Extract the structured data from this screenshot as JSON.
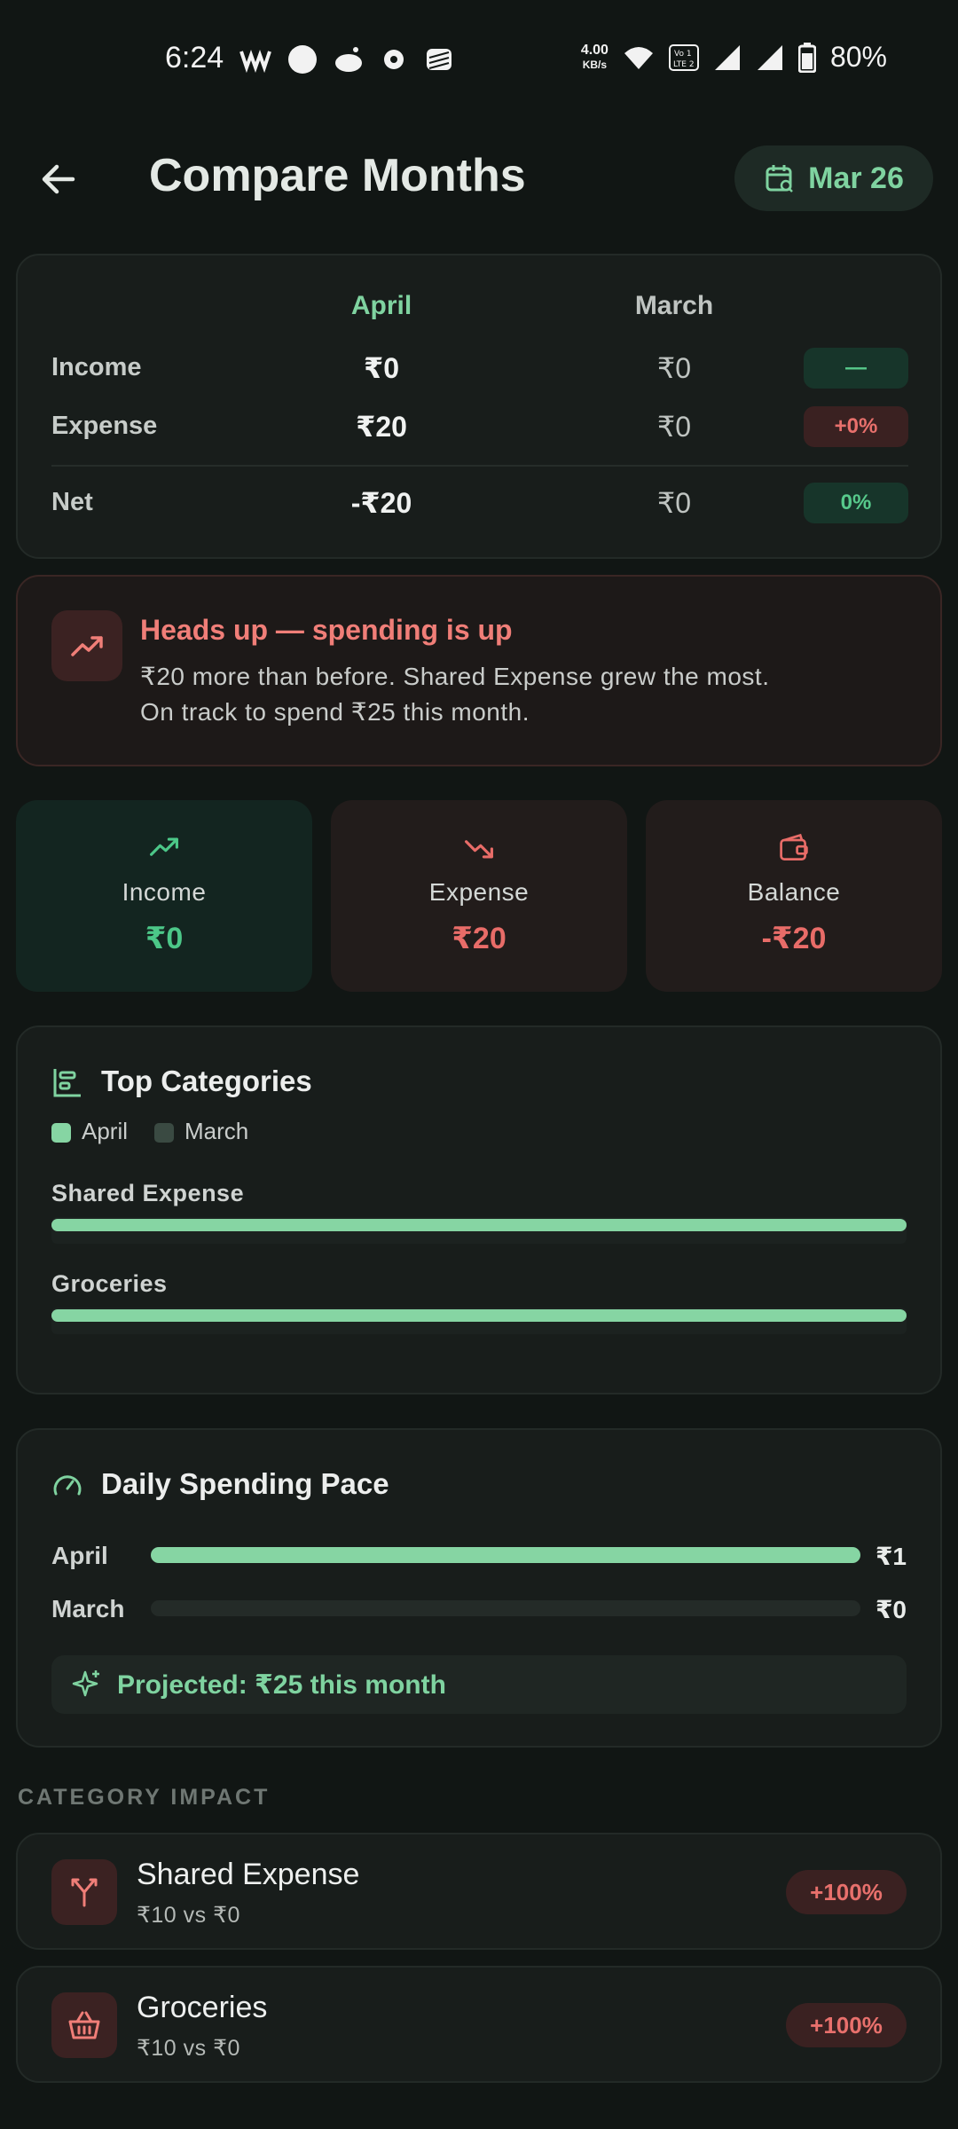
{
  "status_bar": {
    "time": "6:24",
    "net_speed": "4.00",
    "net_unit": "KB/s",
    "volte": "Vo LTE 2",
    "battery": "80%",
    "icons": [
      "webtoon-icon",
      "circle-icon",
      "reddit-icon",
      "settings-gear-icon",
      "stack-icon",
      "wifi-icon",
      "signal-icon",
      "signal-icon",
      "battery-icon"
    ]
  },
  "header": {
    "title": "Compare Months",
    "date_chip": "Mar 26",
    "back_icon": "arrow-left-icon",
    "date_icon": "calendar-search-icon"
  },
  "compare": {
    "col_current": "April",
    "col_previous": "March",
    "rows": [
      {
        "label": "Income",
        "current": "₹0",
        "previous": "₹0",
        "change": "—"
      },
      {
        "label": "Expense",
        "current": "₹20",
        "previous": "₹0",
        "change": "+0%"
      },
      {
        "label": "Net",
        "current": "-₹20",
        "previous": "₹0",
        "change": "0%"
      }
    ]
  },
  "alert": {
    "icon": "trending-up-icon",
    "title": "Heads up — spending is up",
    "line1": "₹20 more than before. Shared Expense grew the most.",
    "line2": "On track to spend ₹25 this month."
  },
  "tiles": [
    {
      "label": "Income",
      "value": "₹0",
      "icon": "trending-up-icon",
      "color": "#4cc788"
    },
    {
      "label": "Expense",
      "value": "₹20",
      "icon": "trending-down-icon",
      "color": "#e86c68"
    },
    {
      "label": "Balance",
      "value": "-₹20",
      "icon": "wallet-icon",
      "color": "#e86c68"
    }
  ],
  "top_categories": {
    "title": "Top Categories",
    "icon": "bar-chart-icon",
    "legend": [
      "April",
      "March"
    ],
    "items": [
      {
        "label": "Shared Expense",
        "april_fraction": 1.0,
        "march_fraction": 0.0
      },
      {
        "label": "Groceries",
        "april_fraction": 1.0,
        "march_fraction": 0.0
      }
    ]
  },
  "daily_pace": {
    "title": "Daily Spending Pace",
    "icon": "gauge-icon",
    "rows": [
      {
        "label": "April",
        "value": "₹1",
        "fraction": 1.0
      },
      {
        "label": "March",
        "value": "₹0",
        "fraction": 0.0
      }
    ],
    "projection": "Projected: ₹25 this month",
    "projection_icon": "sparkles-icon"
  },
  "category_impact": {
    "caption": "CATEGORY IMPACT",
    "items": [
      {
        "name": "Shared Expense",
        "sub": "₹10 vs ₹0",
        "change": "+100%",
        "icon": "split-arrows-icon"
      },
      {
        "name": "Groceries",
        "sub": "₹10 vs ₹0",
        "change": "+100%",
        "icon": "basket-icon"
      }
    ]
  },
  "colors": {
    "background": "#111614",
    "accent_green": "#86d5a3",
    "accent_red": "#e86c68"
  }
}
